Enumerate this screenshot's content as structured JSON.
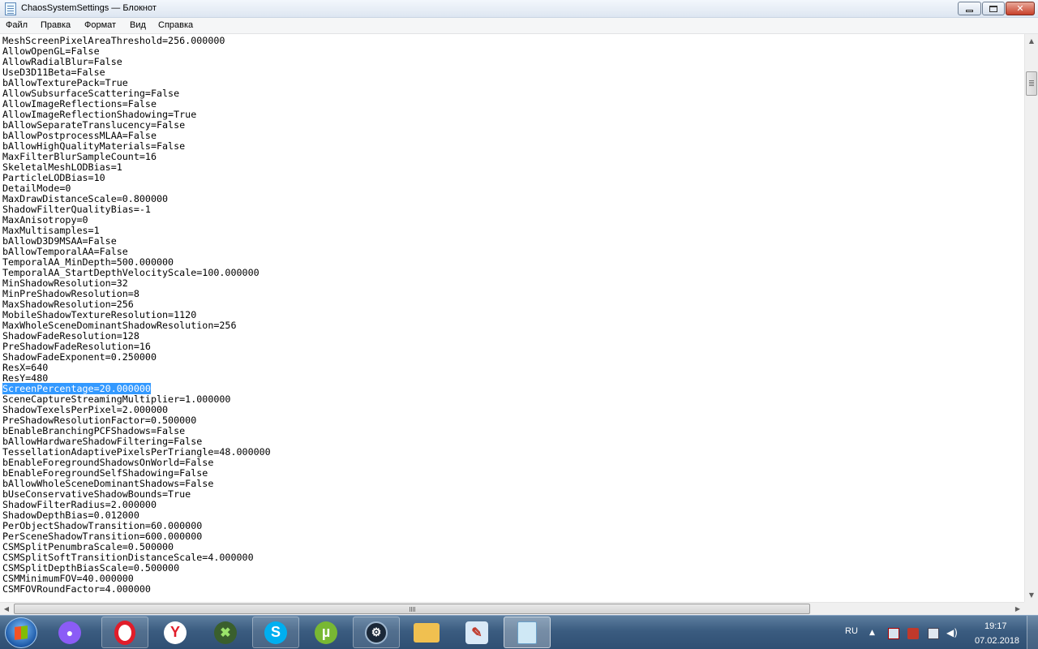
{
  "window": {
    "title": "ChaosSystemSettings — Блокнот",
    "min_label": "",
    "max_label": "",
    "close_label": "✕"
  },
  "menu": [
    "Файл",
    "Правка",
    "Формат",
    "Вид",
    "Справка"
  ],
  "editor": {
    "selected_line_index": 33,
    "lines": [
      "MeshScreenPixelAreaThreshold=256.000000",
      "AllowOpenGL=False",
      "AllowRadialBlur=False",
      "UseD3D11Beta=False",
      "bAllowTexturePack=True",
      "AllowSubsurfaceScattering=False",
      "AllowImageReflections=False",
      "AllowImageReflectionShadowing=True",
      "bAllowSeparateTranslucency=False",
      "bAllowPostprocessMLAA=False",
      "bAllowHighQualityMaterials=False",
      "MaxFilterBlurSampleCount=16",
      "SkeletalMeshLODBias=1",
      "ParticleLODBias=10",
      "DetailMode=0",
      "MaxDrawDistanceScale=0.800000",
      "ShadowFilterQualityBias=-1",
      "MaxAnisotropy=0",
      "MaxMultisamples=1",
      "bAllowD3D9MSAA=False",
      "bAllowTemporalAA=False",
      "TemporalAA_MinDepth=500.000000",
      "TemporalAA_StartDepthVelocityScale=100.000000",
      "MinShadowResolution=32",
      "MinPreShadowResolution=8",
      "MaxShadowResolution=256",
      "MobileShadowTextureResolution=1120",
      "MaxWholeSceneDominantShadowResolution=256",
      "ShadowFadeResolution=128",
      "PreShadowFadeResolution=16",
      "ShadowFadeExponent=0.250000",
      "ResX=640",
      "ResY=480",
      "ScreenPercentage=20.000000",
      "SceneCaptureStreamingMultiplier=1.000000",
      "ShadowTexelsPerPixel=2.000000",
      "PreShadowResolutionFactor=0.500000",
      "bEnableBranchingPCFShadows=False",
      "bAllowHardwareShadowFiltering=False",
      "TessellationAdaptivePixelsPerTriangle=48.000000",
      "bEnableForegroundShadowsOnWorld=False",
      "bEnableForegroundSelfShadowing=False",
      "bAllowWholeSceneDominantShadows=False",
      "bUseConservativeShadowBounds=True",
      "ShadowFilterRadius=2.000000",
      "ShadowDepthBias=0.012000",
      "PerObjectShadowTransition=60.000000",
      "PerSceneShadowTransition=600.000000",
      "CSMSplitPenumbraScale=0.500000",
      "CSMSplitSoftTransitionDistanceScale=4.000000",
      "CSMSplitDepthBiasScale=0.500000",
      "CSMMinimumFOV=40.000000",
      "CSMFOVRoundFactor=4.000000"
    ]
  },
  "taskbar": {
    "items": [
      {
        "name": "microphone-app-icon",
        "color": "#8b5cf6"
      },
      {
        "name": "opera-icon",
        "color": "#e11d2a"
      },
      {
        "name": "yandex-browser-icon",
        "color": "#ffffff"
      },
      {
        "name": "game-app-icon",
        "color": "#4caf50"
      },
      {
        "name": "skype-icon",
        "color": "#00aff0"
      },
      {
        "name": "utorrent-icon",
        "color": "#78b833"
      },
      {
        "name": "steam-icon",
        "color": "#1b2838"
      },
      {
        "name": "file-explorer-icon",
        "color": "#f0c050"
      },
      {
        "name": "paint-icon",
        "color": "#d9e9f7"
      },
      {
        "name": "notepad-icon",
        "color": "#cfe8f5"
      }
    ],
    "language": "RU",
    "time": "19:17",
    "date": "07.02.2018"
  }
}
